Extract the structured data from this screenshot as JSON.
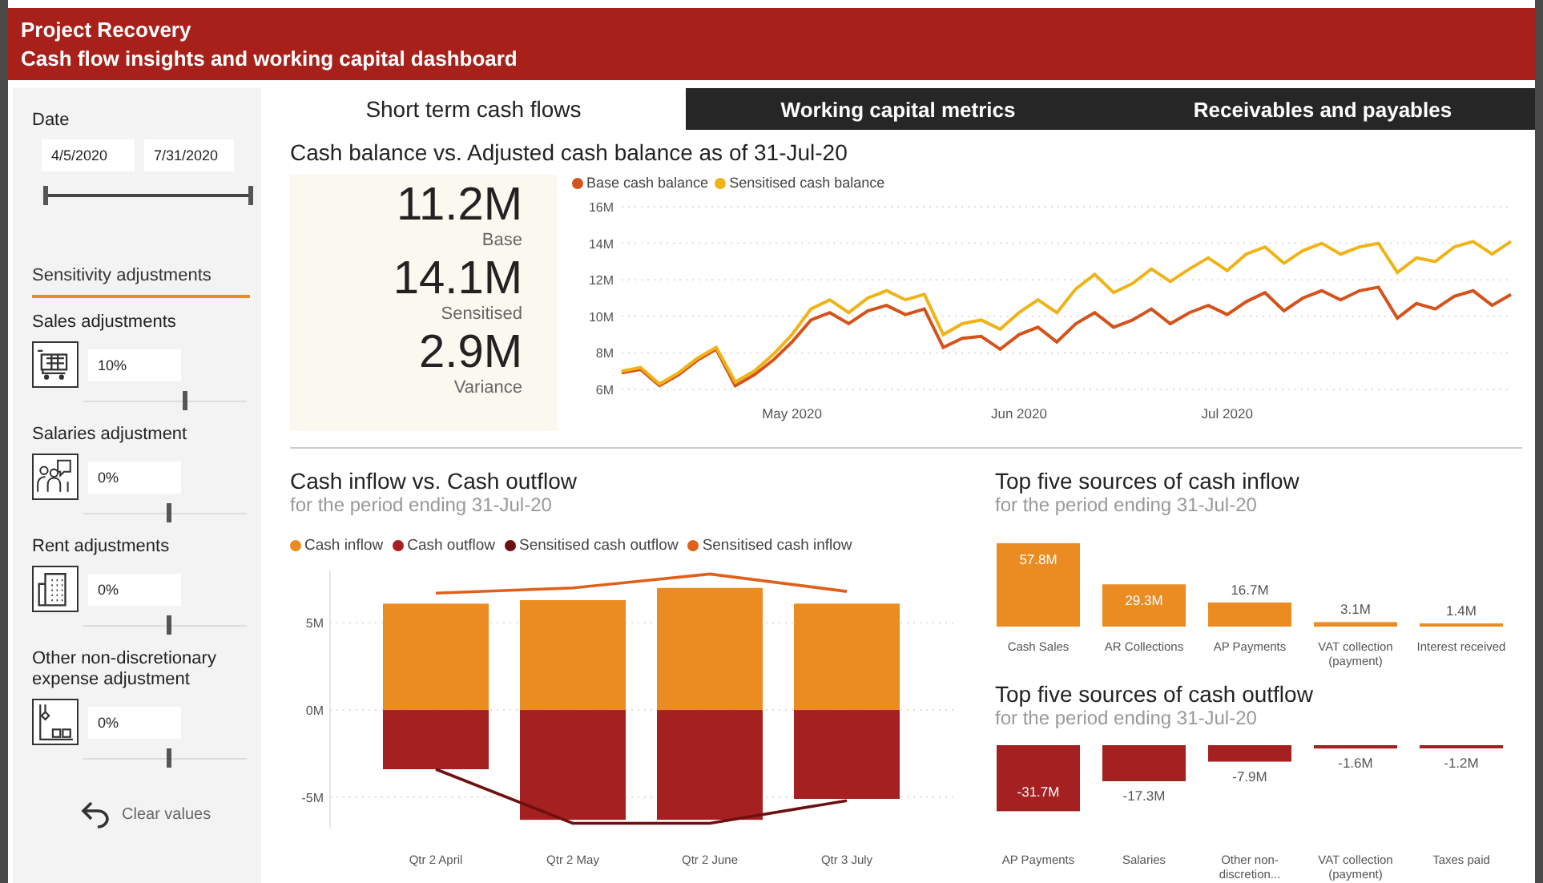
{
  "header": {
    "title": "Project Recovery",
    "subtitle": "Cash flow insights and working capital dashboard"
  },
  "sidebar": {
    "date": {
      "label": "Date",
      "start": "4/5/2020",
      "end": "7/31/2020",
      "thumbs": [
        {
          "level": 0
        },
        {
          "level": 1
        }
      ]
    },
    "section_title": "Sensitivity adjustments",
    "adjustments": [
      {
        "label": "Sales adjustments",
        "value": "10%",
        "level": 0.62
      },
      {
        "label": "Salaries adjustment",
        "value": "0%",
        "level": 0.52
      },
      {
        "label": "Rent adjustments",
        "value": "0%",
        "level": 0.52
      },
      {
        "label": "Other non-discretionary expense adjustment",
        "value": "0%",
        "level": 0.52
      }
    ],
    "clear_button": "Clear values"
  },
  "tabs": [
    {
      "label": "Short term cash flows",
      "selected": true
    },
    {
      "label": "Working capital metrics",
      "selected": false
    },
    {
      "label": "Receivables and payables",
      "selected": false
    }
  ],
  "balance": {
    "title": "Cash balance vs. Adjusted cash balance as of 31-Jul-20",
    "kpis": [
      {
        "value": "11.2M",
        "label": "Base"
      },
      {
        "value": "14.1M",
        "label": "Sensitised"
      },
      {
        "value": "2.9M",
        "label": "Variance"
      }
    ],
    "chart_data": {
      "type": "line",
      "legend": "top",
      "grid": true,
      "categories": [
        null,
        null,
        null,
        null,
        null,
        null,
        null,
        null,
        null,
        "May 2020",
        null,
        null,
        null,
        null,
        null,
        null,
        null,
        null,
        null,
        null,
        null,
        "Jun 2020",
        null,
        null,
        null,
        null,
        null,
        null,
        null,
        null,
        null,
        null,
        "Jul 2020",
        null,
        null,
        null,
        null,
        null,
        null,
        null,
        null,
        null,
        null,
        null,
        null,
        null,
        null,
        null
      ],
      "series": [
        {
          "name": "Base cash balance",
          "color": "#d4531c",
          "values": [
            6.9,
            7.1,
            6.2,
            6.8,
            7.6,
            8.2,
            6.2,
            6.8,
            7.6,
            8.6,
            9.8,
            10.2,
            9.6,
            10.3,
            10.6,
            10.1,
            10.4,
            8.3,
            8.8,
            8.9,
            8.2,
            9.0,
            9.4,
            8.6,
            9.6,
            10.2,
            9.4,
            9.8,
            10.4,
            9.6,
            10.2,
            10.6,
            10.1,
            10.8,
            11.3,
            10.3,
            11.0,
            11.4,
            10.9,
            11.4,
            11.6,
            9.9,
            10.7,
            10.4,
            11.1,
            11.4,
            10.6,
            11.2
          ]
        },
        {
          "name": "Sensitised cash balance",
          "color": "#f0b315",
          "values": [
            7.0,
            7.2,
            6.3,
            6.9,
            7.7,
            8.3,
            6.4,
            7.0,
            7.9,
            9.0,
            10.4,
            10.9,
            10.2,
            11.0,
            11.4,
            10.9,
            11.2,
            9.0,
            9.6,
            9.8,
            9.3,
            10.2,
            10.9,
            10.2,
            11.5,
            12.3,
            11.3,
            11.8,
            12.6,
            11.9,
            12.6,
            13.2,
            12.5,
            13.4,
            13.8,
            12.9,
            13.6,
            14.0,
            13.4,
            13.8,
            14.0,
            12.4,
            13.2,
            13.0,
            13.8,
            14.1,
            13.4,
            14.1
          ]
        }
      ],
      "ylim": [
        6,
        16
      ],
      "yticks": [
        {
          "value": 6,
          "label": "6M"
        },
        {
          "value": 8,
          "label": "8M"
        },
        {
          "value": 10,
          "label": "10M"
        },
        {
          "value": 12,
          "label": "12M"
        },
        {
          "value": 14,
          "label": "14M"
        },
        {
          "value": 16,
          "label": "16M"
        }
      ]
    }
  },
  "flows": {
    "title": "Cash inflow vs. Cash outflow",
    "subtitle": "for the period ending 31-Jul-20",
    "chart_data": {
      "type": "bar",
      "stacked": true,
      "legend": "top",
      "grid": true,
      "categories": [
        "Qtr 2 April",
        "Qtr 2 May",
        "Qtr 2 June",
        "Qtr 3 July"
      ],
      "series": [
        {
          "name": "Cash inflow",
          "type": "bar",
          "color": "#eb8c23",
          "values": [
            6.1,
            6.3,
            7.0,
            6.1
          ]
        },
        {
          "name": "Cash outflow",
          "type": "bar",
          "color": "#a52020",
          "values": [
            -3.4,
            -6.3,
            -6.3,
            -5.1
          ]
        },
        {
          "name": "Sensitised cash outflow",
          "type": "line",
          "color": "#6e1010",
          "values": [
            -3.4,
            -6.5,
            -6.5,
            -5.2
          ]
        },
        {
          "name": "Sensitised cash inflow",
          "type": "line",
          "color": "#e0601a",
          "values": [
            6.7,
            7.0,
            7.8,
            6.8
          ]
        }
      ],
      "ylim": [
        -6.8,
        8
      ],
      "yticks": [
        {
          "value": 5,
          "label": "5M"
        },
        {
          "value": 0,
          "label": "0M"
        },
        {
          "value": -5,
          "label": "-5M"
        }
      ]
    }
  },
  "inflow_sources": {
    "title": "Top five sources of cash inflow",
    "subtitle": "for the period ending 31-Jul-20",
    "chart_data": {
      "type": "bar",
      "categories": [
        "Cash Sales",
        "AR Collections",
        "AP Payments",
        "VAT collection (payment)",
        "Interest received"
      ],
      "values": [
        57.8,
        29.3,
        16.7,
        3.1,
        1.4
      ],
      "value_labels": [
        "57.8M",
        "29.3M",
        "16.7M",
        "3.1M",
        "1.4M"
      ]
    }
  },
  "outflow_sources": {
    "title": "Top five sources of cash outflow",
    "subtitle": "for the period ending 31-Jul-20",
    "chart_data": {
      "type": "bar",
      "categories": [
        "AP Payments",
        "Salaries",
        "Other non-discretion...",
        "VAT collection (payment)",
        "Taxes paid"
      ],
      "values": [
        -31.7,
        -17.3,
        -7.9,
        -1.6,
        -1.2
      ],
      "value_labels": [
        "-31.7M",
        "-17.3M",
        "-7.9M",
        "-1.6M",
        "-1.2M"
      ]
    }
  }
}
